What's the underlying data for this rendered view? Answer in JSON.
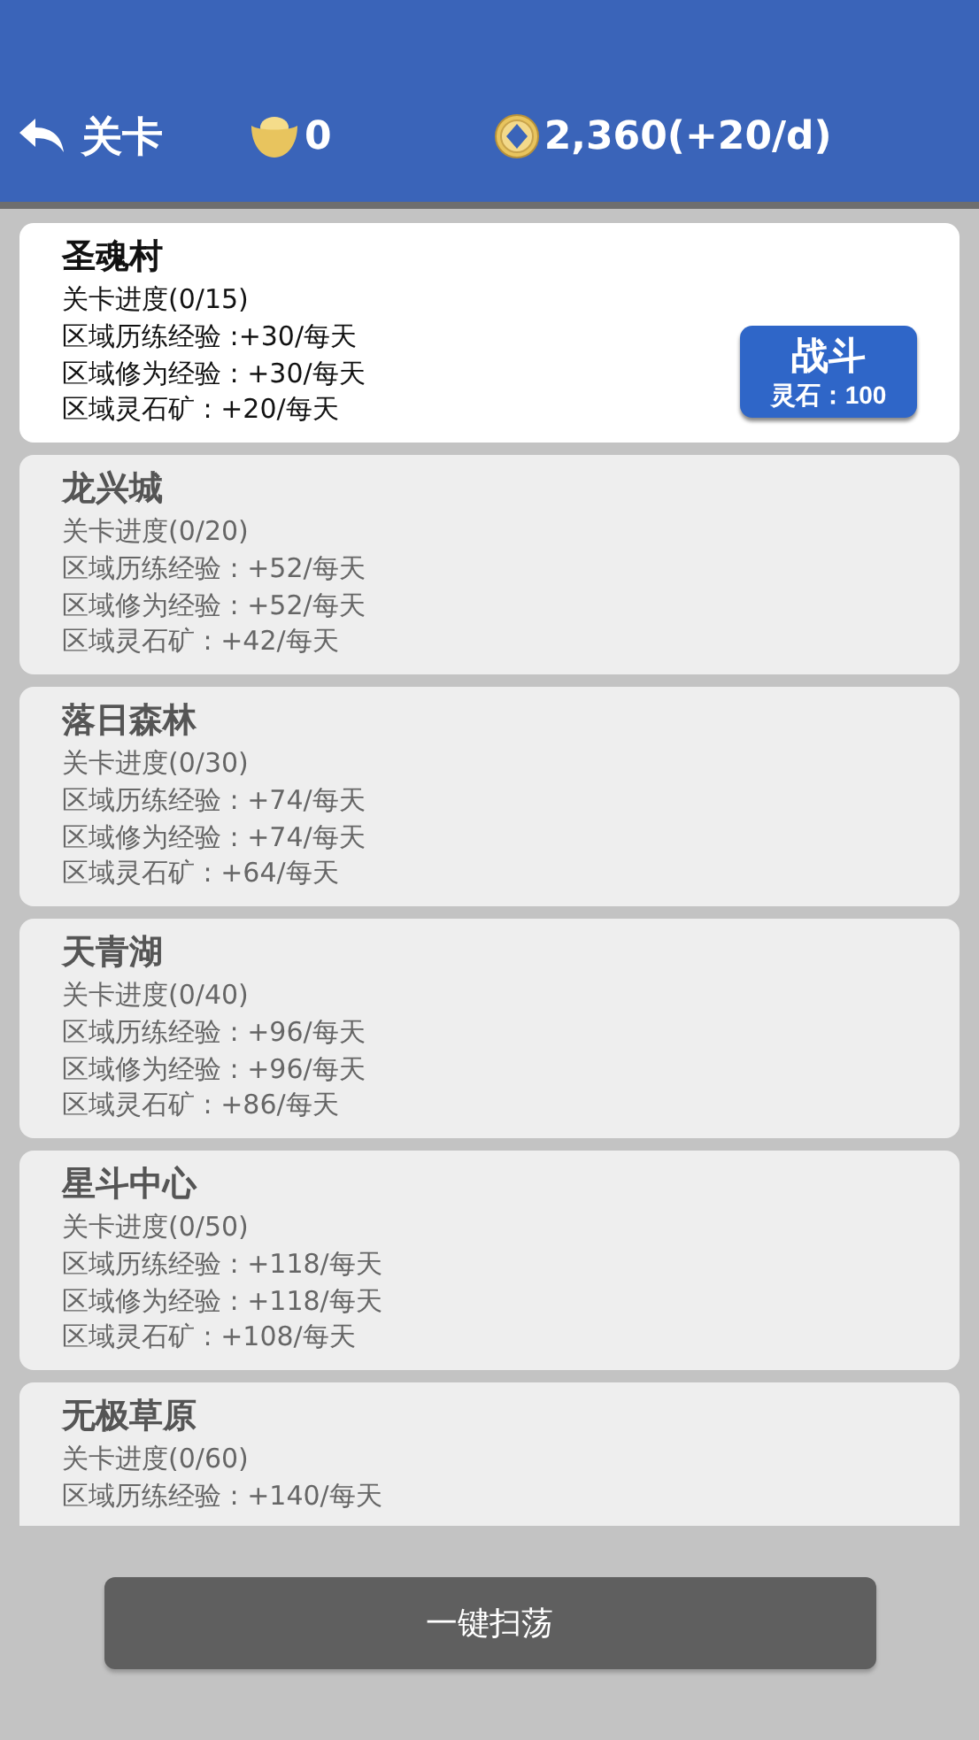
{
  "header": {
    "title": "关卡",
    "ingots": "0",
    "coins": "2,360(+20/d)"
  },
  "stages": [
    {
      "name": "圣魂村",
      "progress": "关卡进度(0/15)",
      "stats": [
        "区域历练经验 :+30/每天",
        "区域修为经验 : +30/每天",
        "区域灵石矿 : +20/每天"
      ],
      "unlocked": true,
      "action": {
        "label": "战斗",
        "cost": "灵石：100"
      }
    },
    {
      "name": "龙兴城",
      "progress": "关卡进度(0/20)",
      "stats": [
        "区域历练经验 : +52/每天",
        "区域修为经验 : +52/每天",
        "区域灵石矿 : +42/每天"
      ],
      "unlocked": false
    },
    {
      "name": "落日森林",
      "progress": "关卡进度(0/30)",
      "stats": [
        "区域历练经验 : +74/每天",
        "区域修为经验 : +74/每天",
        "区域灵石矿 : +64/每天"
      ],
      "unlocked": false
    },
    {
      "name": "天青湖",
      "progress": "关卡进度(0/40)",
      "stats": [
        "区域历练经验 : +96/每天",
        "区域修为经验 : +96/每天",
        "区域灵石矿 : +86/每天"
      ],
      "unlocked": false
    },
    {
      "name": "星斗中心",
      "progress": "关卡进度(0/50)",
      "stats": [
        "区域历练经验 : +118/每天",
        "区域修为经验 : +118/每天",
        "区域灵石矿 : +108/每天"
      ],
      "unlocked": false
    },
    {
      "name": "无极草原",
      "progress": "关卡进度(0/60)",
      "stats": [
        "区域历练经验 : +140/每天"
      ],
      "unlocked": false
    }
  ],
  "sweep_button": "一键扫荡"
}
